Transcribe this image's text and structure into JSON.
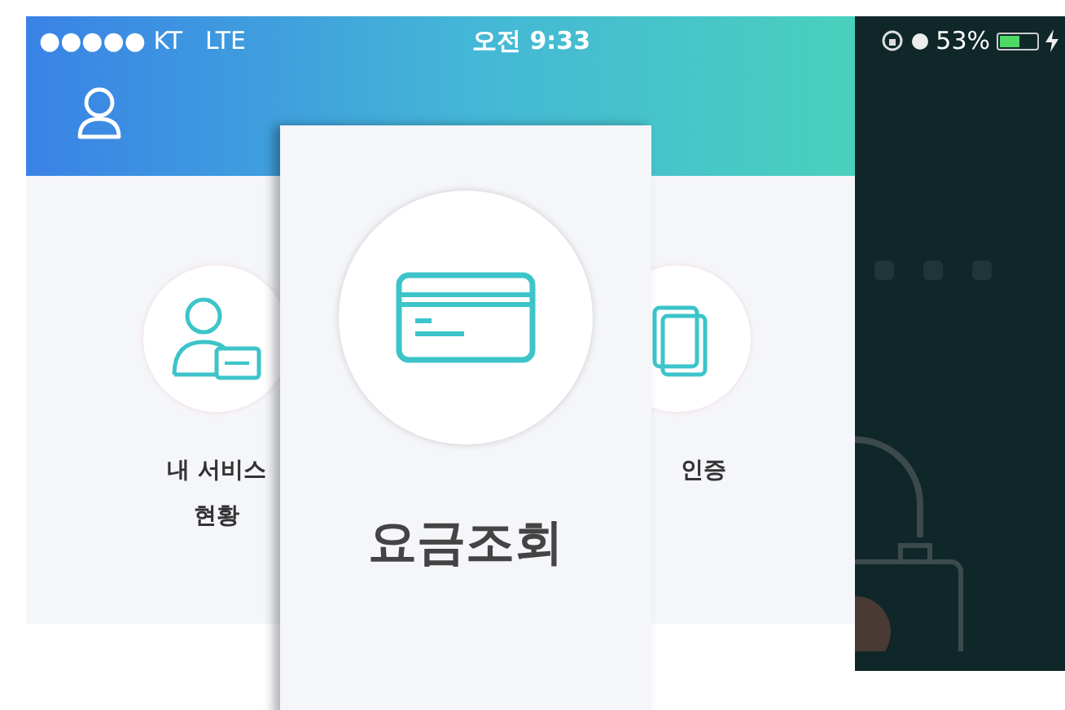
{
  "status_bar": {
    "carrier": "●●●●● KT",
    "network": "LTE",
    "time": "오전 9:33",
    "battery_text": "53%",
    "battery": {
      "level": 0.53,
      "charging": true
    }
  },
  "menu_items": [
    {
      "kind": "id-card",
      "lines": [
        "내 서비스",
        "현황"
      ]
    },
    {
      "kind": "documents",
      "lines": [
        "인증"
      ]
    }
  ],
  "popup": {
    "kind": "card",
    "label": "요금조회"
  }
}
